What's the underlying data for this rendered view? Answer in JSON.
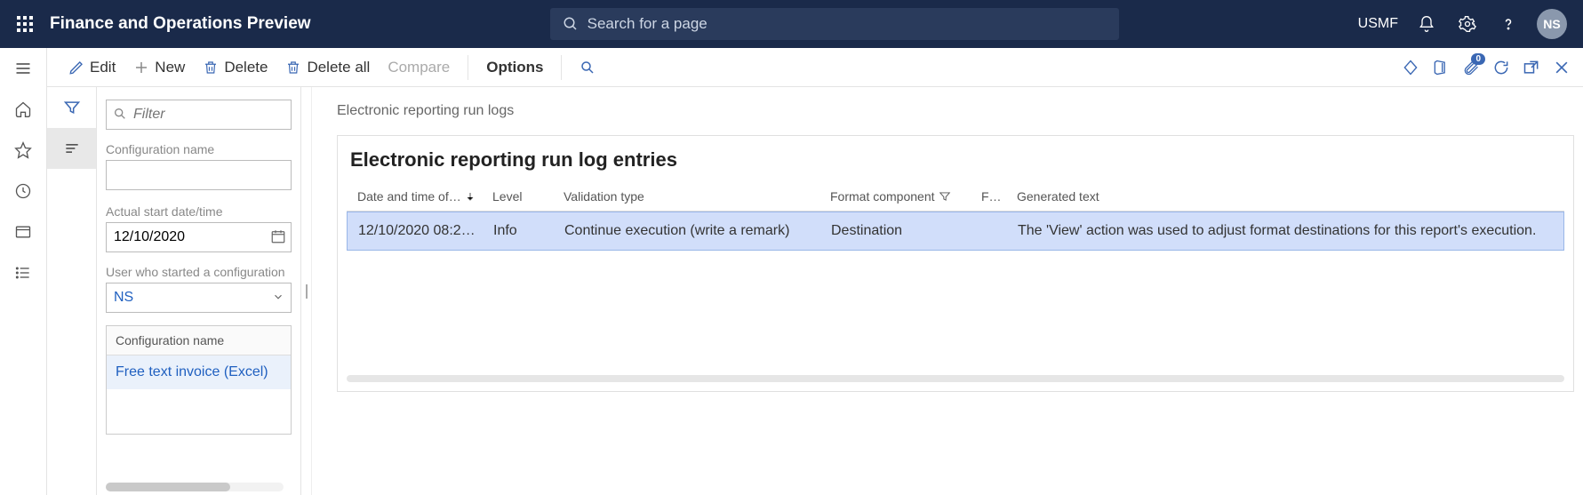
{
  "header": {
    "app_title": "Finance and Operations Preview",
    "search_placeholder": "Search for a page",
    "company": "USMF",
    "avatar": "NS"
  },
  "actions": {
    "edit": "Edit",
    "new": "New",
    "delete": "Delete",
    "delete_all": "Delete all",
    "compare": "Compare",
    "options": "Options",
    "attach_count": "0"
  },
  "filter": {
    "placeholder": "Filter",
    "config_label": "Configuration name",
    "config_value": "",
    "date_label": "Actual start date/time",
    "date_value": "12/10/2020",
    "user_label": "User who started a configuration",
    "user_value": "NS",
    "list_header": "Configuration name",
    "list_item": "Free text invoice (Excel)"
  },
  "content": {
    "breadcrumb": "Electronic reporting run logs",
    "card_title": "Electronic reporting run log entries",
    "columns": {
      "date": "Date and time of…",
      "level": "Level",
      "vtype": "Validation type",
      "fcomp": "Format component",
      "f": "F…",
      "gen": "Generated text"
    },
    "row": {
      "date": "12/10/2020 08:2…",
      "level": "Info",
      "vtype": "Continue execution (write a remark)",
      "fcomp": "Destination",
      "f": "",
      "gen": "The 'View' action was used to adjust format destinations for this report's execution."
    }
  }
}
